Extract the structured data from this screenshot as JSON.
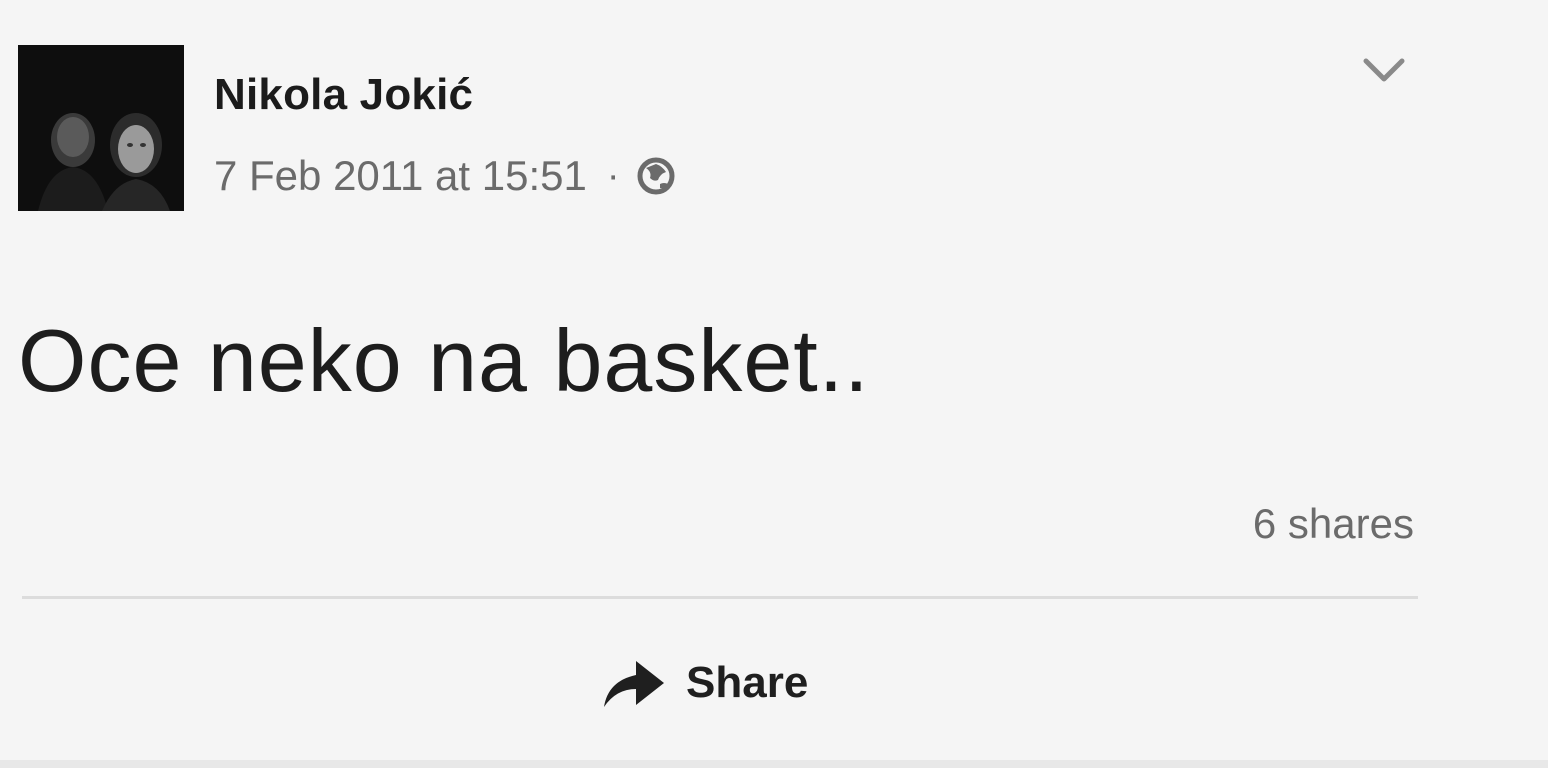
{
  "post": {
    "author": "Nikola Jokić",
    "timestamp": "7 Feb 2011 at 15:51",
    "separator": "·",
    "privacy_icon": "globe-icon",
    "menu_icon": "chevron-down-icon",
    "text": "Oce neko na basket..",
    "shares": "6 shares"
  },
  "actions": {
    "share_label": "Share",
    "share_icon": "share-arrow-icon"
  },
  "colors": {
    "background": "#f5f5f5",
    "text_primary": "#1d1d1d",
    "text_secondary": "#6b6b6b",
    "divider": "#dcdcdc"
  }
}
